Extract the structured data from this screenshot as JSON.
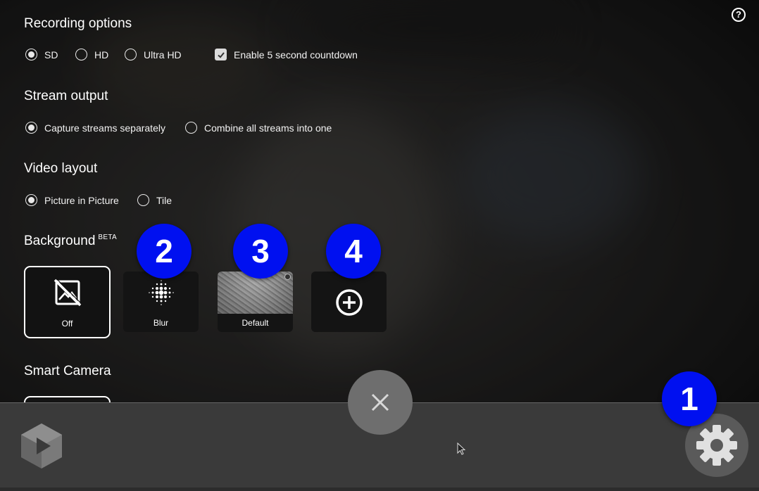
{
  "help": {
    "label": "?"
  },
  "sections": {
    "recording": {
      "title": "Recording options",
      "options": [
        {
          "label": "SD",
          "selected": true
        },
        {
          "label": "HD",
          "selected": false
        },
        {
          "label": "Ultra HD",
          "selected": false
        }
      ],
      "countdown": {
        "label": "Enable 5 second countdown",
        "checked": true
      }
    },
    "stream": {
      "title": "Stream output",
      "options": [
        {
          "label": "Capture streams separately",
          "selected": true
        },
        {
          "label": "Combine all streams into one",
          "selected": false
        }
      ]
    },
    "layout": {
      "title": "Video layout",
      "options": [
        {
          "label": "Picture in Picture",
          "selected": true
        },
        {
          "label": "Tile",
          "selected": false
        }
      ]
    },
    "background": {
      "title": "Background",
      "badge": "BETA",
      "tiles": [
        {
          "label": "Off",
          "icon": "no-image-icon",
          "selected": true
        },
        {
          "label": "Blur",
          "icon": "blur-dots-icon",
          "selected": false
        },
        {
          "label": "Default",
          "icon": "texture-image",
          "selected": false
        },
        {
          "label": "",
          "icon": "add-circle-icon",
          "selected": false
        }
      ]
    },
    "smart_camera": {
      "title": "Smart Camera"
    }
  },
  "annotations": {
    "one": "1",
    "two": "2",
    "three": "3",
    "four": "4",
    "color": "#0010f0"
  },
  "toolbar": {
    "close_icon": "close-icon",
    "settings_icon": "gear-icon",
    "logo_icon": "panopto-logo-icon"
  }
}
